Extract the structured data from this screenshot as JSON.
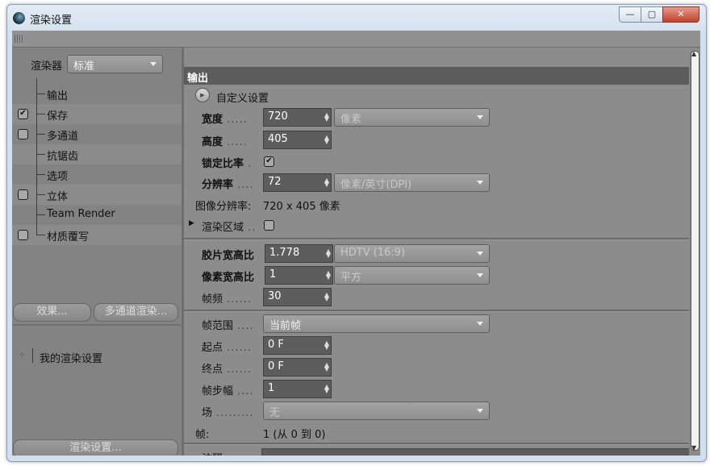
{
  "window": {
    "title": "渲染设置",
    "buttons": {
      "minimize": "—",
      "maximize": "▢",
      "close": "✕"
    }
  },
  "left_panel": {
    "renderer_label": "渲染器",
    "renderer_value": "标准",
    "tree": [
      {
        "label": "输出",
        "has_checkbox": false,
        "checked": false
      },
      {
        "label": "保存",
        "has_checkbox": true,
        "checked": true
      },
      {
        "label": "多通道",
        "has_checkbox": true,
        "checked": false
      },
      {
        "label": "抗锯齿",
        "has_checkbox": false,
        "checked": false
      },
      {
        "label": "选项",
        "has_checkbox": false,
        "checked": false
      },
      {
        "label": "立体",
        "has_checkbox": true,
        "checked": false
      },
      {
        "label": "Team Render",
        "has_checkbox": false,
        "checked": false
      },
      {
        "label": "材质覆写",
        "has_checkbox": true,
        "checked": false
      }
    ],
    "effects_button": "效果...",
    "multipass_button": "多通道渲染...",
    "preset_name": "我的渲染设置",
    "render_settings_button": "渲染设置..."
  },
  "output": {
    "section_title": "输出",
    "custom_settings": "自定义设置",
    "width": {
      "label": "宽度",
      "value": "720",
      "unit": "像素"
    },
    "height": {
      "label": "高度",
      "value": "405"
    },
    "lock_ratio": {
      "label": "锁定比率",
      "checked": true
    },
    "resolution": {
      "label": "分辨率",
      "value": "72",
      "unit": "像素/英寸(DPI)"
    },
    "image_resolution_label": "图像分辨率:",
    "image_resolution_value": "720 x 405 像素",
    "render_region": {
      "label": "渲染区域",
      "checked": false
    },
    "film_aspect": {
      "label": "胶片宽高比",
      "value": "1.778",
      "preset": "HDTV (16:9)"
    },
    "pixel_aspect": {
      "label": "像素宽高比",
      "value": "1",
      "preset": "平方"
    },
    "frame_rate": {
      "label": "帧频",
      "value": "30"
    },
    "frame_range": {
      "label": "帧范围",
      "value": "当前帧"
    },
    "start": {
      "label": "起点",
      "value": "0 F"
    },
    "end": {
      "label": "终点",
      "value": "0 F"
    },
    "frame_step": {
      "label": "帧步幅",
      "value": "1"
    },
    "field": {
      "label": "场",
      "value": "无"
    },
    "frames_label": "帧:",
    "frames_value": "1 (从 0 到 0)",
    "notes_label": "注释"
  }
}
